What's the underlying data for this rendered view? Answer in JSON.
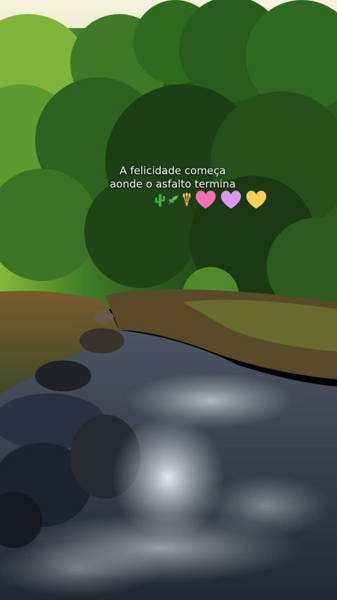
{
  "video": {
    "caption": {
      "line1": "A felicidade começa",
      "line2": "aonde o asfalto termina"
    },
    "emojis": [
      "cactus-icon",
      "herb-icon",
      "sheaf-icon",
      "pink-heart-icon",
      "light-purple-heart-icon",
      "yellow-heart-icon"
    ],
    "colors": {
      "pink_heart": "#f06fb0",
      "purple_heart": "#d79af0",
      "yellow_heart": "#f6cf5a",
      "foliage": "#2f6a24",
      "water": "#c9ccd2"
    }
  }
}
